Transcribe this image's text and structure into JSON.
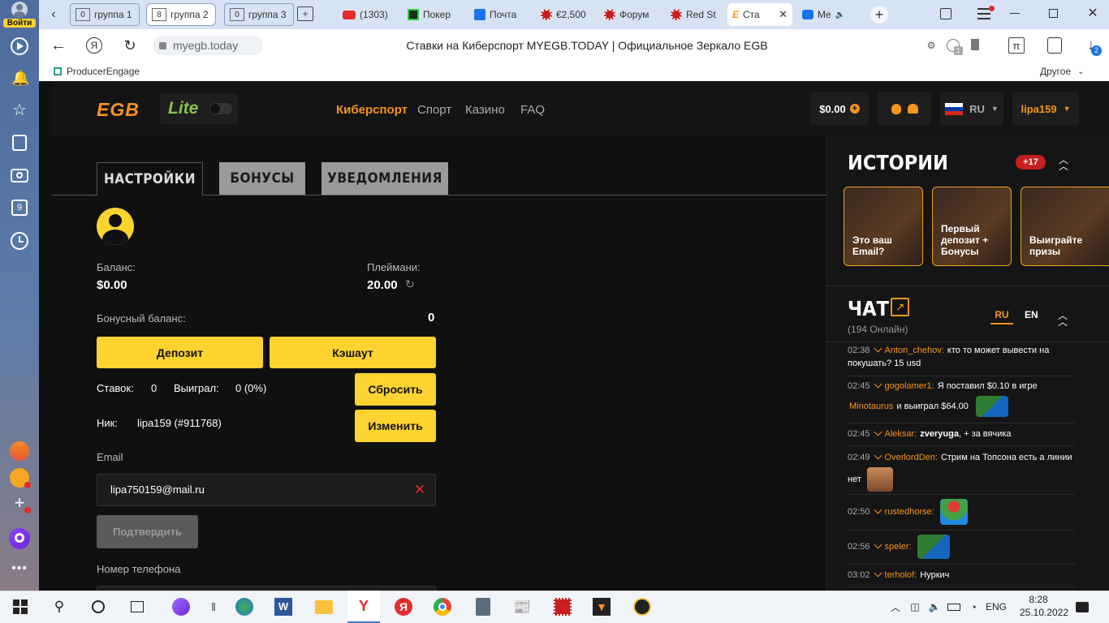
{
  "yandex_sidebar": {
    "login": "Войти"
  },
  "tabs": [
    {
      "label": "группа 1",
      "num": "0"
    },
    {
      "label": "группа 2",
      "num": "8"
    },
    {
      "label": "группа 3",
      "num": "0"
    },
    {
      "label": "(1303)"
    },
    {
      "label": "Покер"
    },
    {
      "label": "Почта"
    },
    {
      "label": "€2,500"
    },
    {
      "label": "Форум"
    },
    {
      "label": "Red St"
    },
    {
      "label": "Ста"
    },
    {
      "label": "Me"
    }
  ],
  "address": {
    "url": "myegb.today",
    "page_title": "Ставки на Киберспорт MYEGB.TODAY | Официальное Зеркало EGB",
    "downloads_badge": "2",
    "ext_badge": "1"
  },
  "bookmarks": {
    "item": "ProducerEngage",
    "other": "Другое"
  },
  "header": {
    "logo": "EGB",
    "lite": "Lite",
    "nav": [
      "Киберспорт",
      "Спорт",
      "Казино",
      "FAQ"
    ],
    "balance": "$0.00",
    "lang": "RU",
    "user": "lipa159"
  },
  "profile_tabs": [
    "НАСТРОЙКИ",
    "БОНУСЫ",
    "УВЕДОМЛЕНИЯ"
  ],
  "profile": {
    "balance_label": "Баланс:",
    "balance": "$0.00",
    "playmoney_label": "Плеймани:",
    "playmoney": "20.00",
    "bonus_label": "Бонусный баланс:",
    "bonus": "0",
    "deposit": "Депозит",
    "cashout": "Кэшаут",
    "bets_label": "Ставок:",
    "bets": "0",
    "won_label": "Выиграл:",
    "won": "0 (0%)",
    "reset": "Сбросить",
    "nick_label": "Ник:",
    "nick": "lipa159 (#911768)",
    "edit": "Изменить",
    "email_label": "Email",
    "email": "lipa750159@mail.ru",
    "confirm": "Подтвердить",
    "phone_label": "Номер телефона"
  },
  "stories": {
    "title": "ИСТОРИИ",
    "badge": "+17",
    "items": [
      "Это ваш Email?",
      "Первый депозит + Бонусы",
      "Выиграйте призы"
    ]
  },
  "chat": {
    "title": "ЧАТ",
    "online": "(194 Онлайн)",
    "lang_ru": "RU",
    "lang_en": "EN",
    "messages": [
      {
        "time": "02:38",
        "user": "Anton_chehov:",
        "text": "кто то может вывести на покушать? 15 usd"
      },
      {
        "time": "02:45",
        "user": "gogolamer1:",
        "text": "Я поставил $0.10 в игре",
        "game": "Minotaurus",
        "text2": "и выиграл $64.00"
      },
      {
        "time": "02:45",
        "user": "Aleksar:",
        "mention": "zveryuga",
        "text": ", + за вячика"
      },
      {
        "time": "02:49",
        "user": "OverlordDen:",
        "text": "Стрим на Топсона есть а линии нет"
      },
      {
        "time": "02:50",
        "user": "rustedhorse:",
        "text": ""
      },
      {
        "time": "02:56",
        "user": "speler:",
        "text": ""
      },
      {
        "time": "03:02",
        "user": "terholof:",
        "text": "Нуркич"
      }
    ]
  },
  "taskbar": {
    "lang": "ENG",
    "time": "8:28",
    "date": "25.10.2022"
  }
}
